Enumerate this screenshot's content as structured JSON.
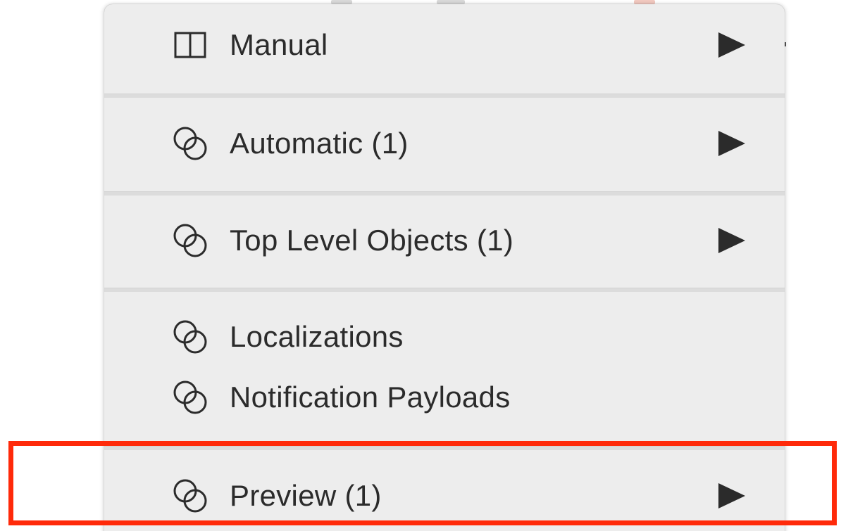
{
  "menu": {
    "items": [
      {
        "label": "Manual",
        "icon": "split-panes-icon",
        "has_submenu": true
      },
      {
        "label": "Automatic (1)",
        "icon": "linked-circles-icon",
        "has_submenu": true
      },
      {
        "label": "Top Level Objects (1)",
        "icon": "linked-circles-icon",
        "has_submenu": true
      },
      {
        "label": "Localizations",
        "icon": "linked-circles-icon",
        "has_submenu": false
      },
      {
        "label": "Notification Payloads",
        "icon": "linked-circles-icon",
        "has_submenu": false
      },
      {
        "label": "Preview (1)",
        "icon": "linked-circles-icon",
        "has_submenu": true
      }
    ]
  },
  "annotation": {
    "highlight_color": "#ff2a0a",
    "highlighted_item": "Preview (1)"
  },
  "colors": {
    "menu_background": "#ededed",
    "text": "#2b2b2b",
    "separator": "#dcdcdc"
  }
}
